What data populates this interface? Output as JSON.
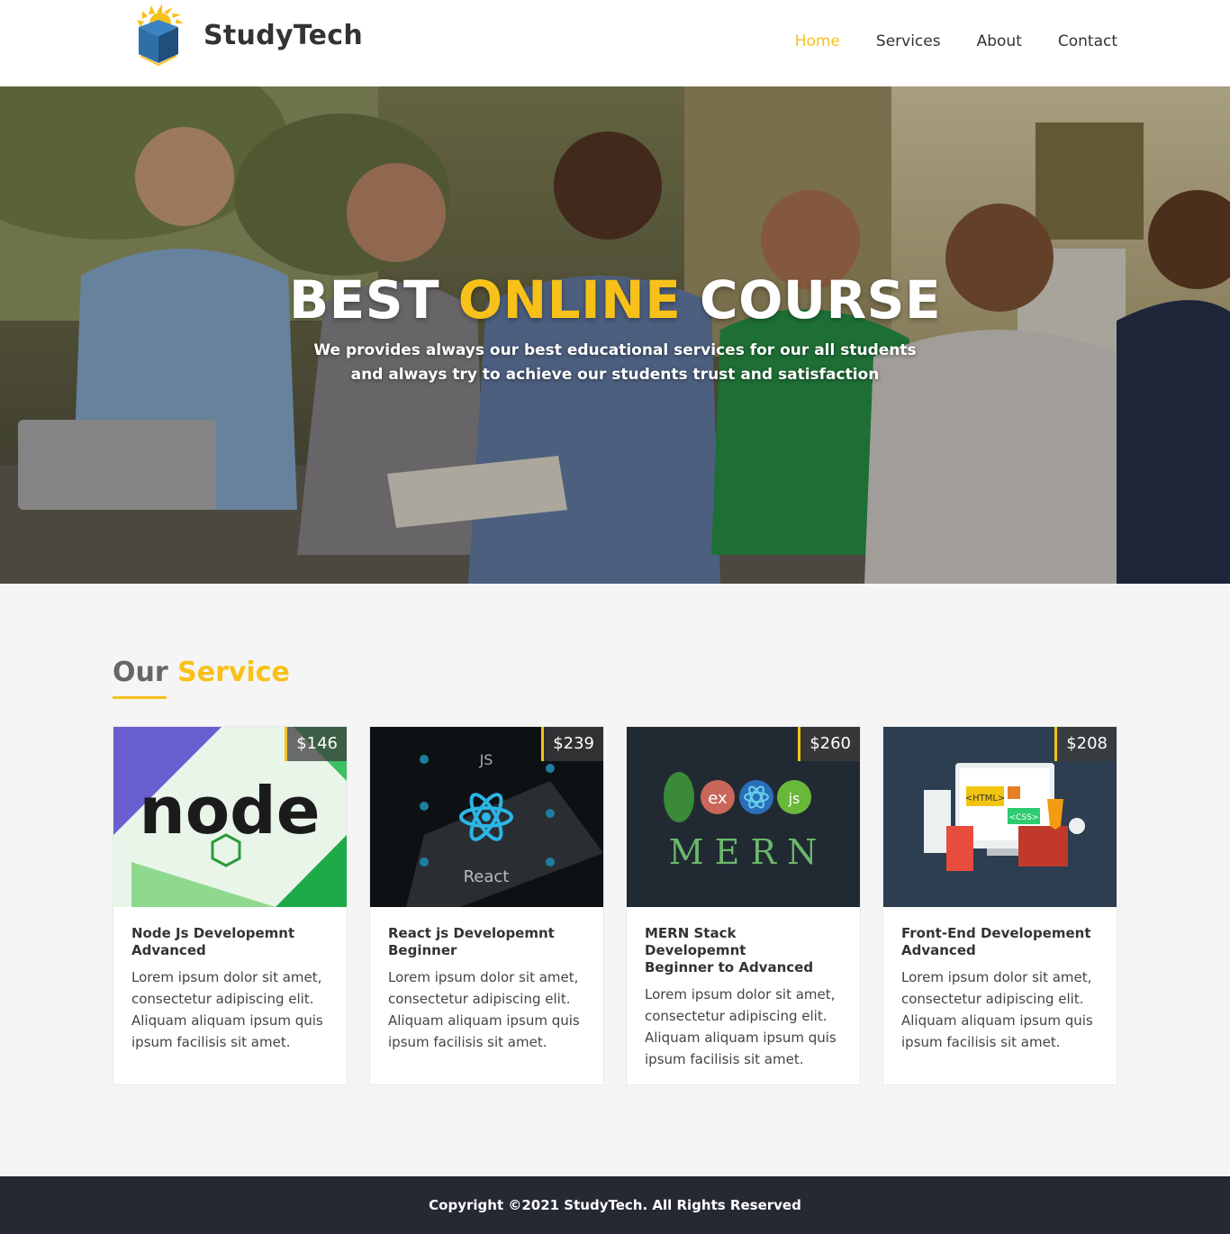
{
  "brand": {
    "name": "StudyTech",
    "logo_icon": "book-sun-logo-icon"
  },
  "nav": {
    "items": [
      {
        "label": "Home",
        "active": true
      },
      {
        "label": "Services",
        "active": false
      },
      {
        "label": "About",
        "active": false
      },
      {
        "label": "Contact",
        "active": false
      }
    ]
  },
  "hero": {
    "title_part1": "BEST ",
    "title_highlight": "ONLINE",
    "title_part2": " COURSE",
    "subtitle_line1": "We provides always our best educational services for our all students",
    "subtitle_line2": "and always try to achieve our students trust and satisfaction"
  },
  "services": {
    "title": "Our ",
    "title_highlight": "Service",
    "cards": [
      {
        "price": "$146",
        "title_line1": "Node Js Developemnt",
        "title_line2": "Advanced",
        "desc": "Lorem ipsum dolor sit amet, consectetur adipiscing elit. Aliquam aliquam ipsum quis ipsum facilisis sit amet.",
        "image_text": "node"
      },
      {
        "price": "$239",
        "title_line1": "React js Developemnt",
        "title_line2": "Beginner",
        "desc": "Lorem ipsum dolor sit amet, consectetur adipiscing elit. Aliquam aliquam ipsum quis ipsum facilisis sit amet.",
        "image_text": "React",
        "image_label_js": "JS"
      },
      {
        "price": "$260",
        "title_line1": "MERN Stack Developemnt",
        "title_line2": "Beginner to Advanced",
        "desc": "Lorem ipsum dolor sit amet, consectetur adipiscing elit. Aliquam aliquam ipsum quis ipsum facilisis sit amet.",
        "image_text": "M E R N"
      },
      {
        "price": "$208",
        "title_line1": "Front-End Developement",
        "title_line2": "Advanced",
        "desc": "Lorem ipsum dolor sit amet, consectetur adipiscing elit. Aliquam aliquam ipsum quis ipsum facilisis sit amet.",
        "image_text_html": "<HTML>",
        "image_text_css": "<CSS>"
      }
    ]
  },
  "footer": {
    "copyright": "Copyright ©2021 StudyTech. All Rights Reserved"
  },
  "colors": {
    "accent": "#f7c11a",
    "footer_bg": "#262834",
    "page_bg": "#f5f5f5"
  }
}
